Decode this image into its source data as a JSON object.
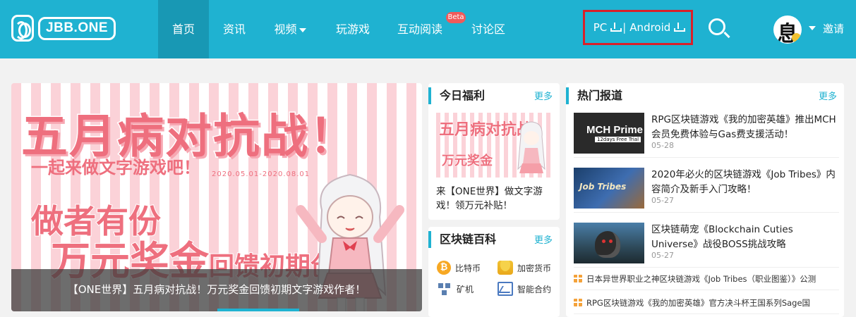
{
  "brand": {
    "name": "JBB.ONE"
  },
  "nav": {
    "home": "首页",
    "news": "资讯",
    "video": "视频",
    "games": "玩游戏",
    "interactive": "互动阅读",
    "beta": "Beta",
    "forum": "讨论区"
  },
  "download": {
    "pc": "PC",
    "separator": "|",
    "android": "Android"
  },
  "user": {
    "avatar_char": "息",
    "invite": "邀请"
  },
  "colors": {
    "primary": "#1fb2d1",
    "highlight_border": "#d9202a",
    "banner_pink": "#ee6f7e"
  },
  "banner": {
    "headline": "五月病对抗战！",
    "subline": "一起来做文字游戏吧！",
    "dates": "2020.05.01-2020.08.01",
    "line2": "做者有份",
    "line3_big": "万元奖金",
    "line3_small": "回馈初期创作！",
    "caption": "【ONE世界】五月病对抗战！万元奖金回馈初期文字游戏作者！"
  },
  "welfare": {
    "title": "今日福利",
    "more": "更多",
    "thumb_title": "五月病对抗战",
    "thumb_sub": "万元奖金",
    "desc": "来【ONE世界】做文字游戏！领万元补贴！"
  },
  "chain": {
    "title": "区块链百科",
    "more": "更多",
    "items": [
      {
        "label": "比特币",
        "icon": "bitcoin-icon"
      },
      {
        "label": "加密货币",
        "icon": "coins-icon"
      },
      {
        "label": "矿机",
        "icon": "miner-icon"
      },
      {
        "label": "智能合约",
        "icon": "contract-icon"
      }
    ]
  },
  "hot": {
    "title": "热门报道",
    "more": "更多",
    "news": [
      {
        "title": "RPG区块链游戏《我的加密英雄》推出MCH会员免费体验与Gas费支援活动！",
        "date": "05-28",
        "img_text": "MCH Prime",
        "img_tag": "12days Free Trial"
      },
      {
        "title": "2020年必火的区块链游戏《Job Tribes》内容简介及新手入门攻略！",
        "date": "05-27",
        "img_text": "Job Tribes"
      },
      {
        "title": "区块链萌宠《Blockchain Cuties Universe》战役BOSS挑战攻略",
        "date": "05-27"
      }
    ],
    "links": [
      "日本异世界职业之神区块链游戏《Job Tribes（职业图鉴）》公测",
      "RPG区块链游戏《我的加密英雄》官方决斗杯王国系列Sage国"
    ]
  }
}
